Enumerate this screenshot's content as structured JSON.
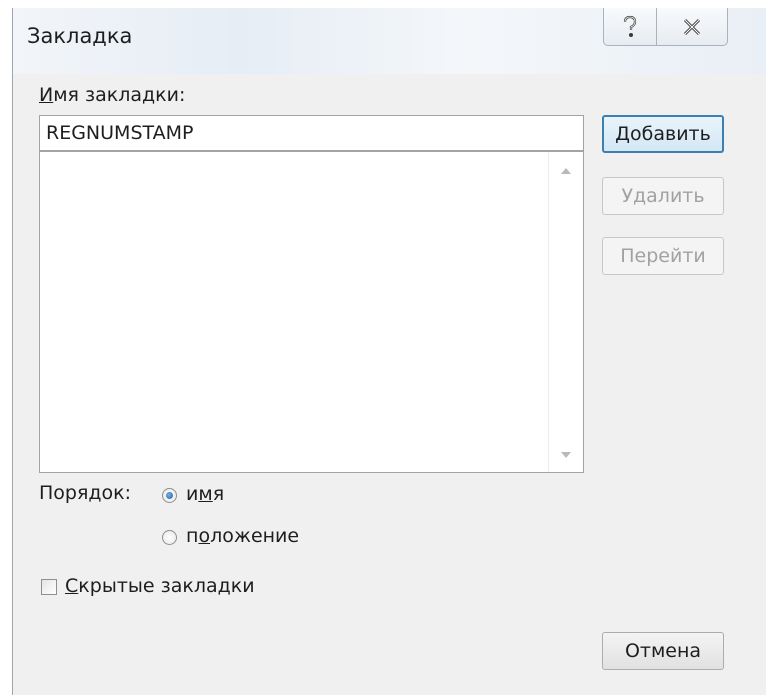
{
  "dialog": {
    "title": "Закладка",
    "help_glyph": "?",
    "close_glyph": "✕"
  },
  "name_field": {
    "label": "Имя закладки:",
    "label_accel": "И",
    "label_rest": "мя закладки:",
    "value": "REGNUMSTAMP"
  },
  "bookmark_list": {
    "items": []
  },
  "buttons": {
    "add": {
      "accel": "Д",
      "rest": "обавить",
      "label": "Добавить"
    },
    "delete": "Удалить",
    "goto": "Перейти",
    "cancel": "Отмена"
  },
  "sort": {
    "label": "Порядок:",
    "options": [
      {
        "label": "имя",
        "pre": "и",
        "accel": "м",
        "post": "я",
        "checked": true
      },
      {
        "label": "положение",
        "pre": "п",
        "accel": "о",
        "post": "ложение",
        "checked": false
      }
    ]
  },
  "hidden_bookmarks": {
    "label": "Скрытые закладки",
    "accel": "С",
    "rest": "крытые закладки",
    "checked": false
  },
  "colors": {
    "default_button_border": "#3c7fb1",
    "disabled_text": "#a2a2a2",
    "radio_selected": "#1f5fa0"
  }
}
